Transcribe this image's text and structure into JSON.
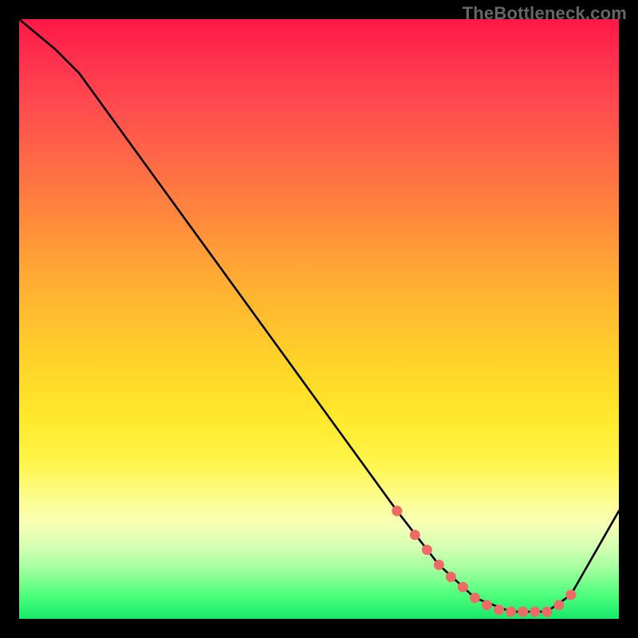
{
  "watermark": "TheBottleneck.com",
  "colors": {
    "background": "#000000",
    "line": "#000000",
    "marker": "#ee6a66",
    "gradient_top": "#ff1846",
    "gradient_bottom": "#17e96a"
  },
  "chart_data": {
    "type": "line",
    "title": "",
    "xlabel": "",
    "ylabel": "",
    "xlim": [
      0,
      100
    ],
    "ylim": [
      0,
      100
    ],
    "grid": false,
    "legend": false,
    "series": [
      {
        "name": "curve",
        "x": [
          0,
          6,
          10,
          63,
          70,
          76,
          82,
          88,
          92,
          100
        ],
        "y": [
          100,
          95,
          91,
          18,
          9,
          3.5,
          1.2,
          1.2,
          4,
          18
        ]
      }
    ],
    "markers": {
      "name": "highlights",
      "x": [
        63,
        66,
        68,
        70,
        72,
        74,
        76,
        78,
        80,
        82,
        84,
        86,
        88,
        90,
        92
      ],
      "y": [
        18,
        14,
        11.5,
        9,
        7,
        5.3,
        3.5,
        2.3,
        1.5,
        1.2,
        1.2,
        1.2,
        1.2,
        2.3,
        4
      ]
    }
  }
}
